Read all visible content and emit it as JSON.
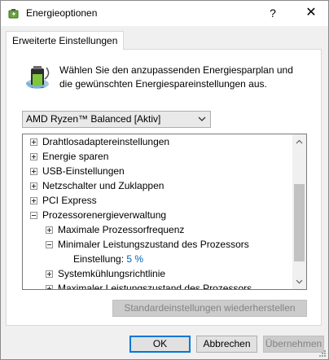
{
  "window": {
    "title": "Energieoptionen",
    "help_label": "?",
    "close_label": "✕"
  },
  "tab": {
    "label": "Erweiterte Einstellungen"
  },
  "description": "Wählen Sie den anzupassenden Energiesparplan und die gewünschten Energiespareinstellungen aus.",
  "plan_select": {
    "value": "AMD Ryzen™ Balanced [Aktiv]"
  },
  "tree": {
    "items": [
      {
        "label": "Drahtlosadaptereinstellungen",
        "state": "collapsed"
      },
      {
        "label": "Energie sparen",
        "state": "collapsed"
      },
      {
        "label": "USB-Einstellungen",
        "state": "collapsed"
      },
      {
        "label": "Netzschalter und Zuklappen",
        "state": "collapsed"
      },
      {
        "label": "PCI Express",
        "state": "collapsed"
      },
      {
        "label": "Prozessorenergieverwaltung",
        "state": "expanded"
      },
      {
        "label": "Maximale Prozessorfrequenz",
        "state": "collapsed"
      },
      {
        "label": "Minimaler Leistungszustand des Prozessors",
        "state": "expanded"
      },
      {
        "label": "Einstellung:",
        "value": "5 %"
      },
      {
        "label": "Systemkühlungsrichtlinie",
        "state": "collapsed"
      },
      {
        "label": "Maximaler Leistungszustand des Prozessors",
        "state": "collapsed"
      }
    ]
  },
  "buttons": {
    "restore": "Standardeinstellungen wiederherstellen",
    "ok": "OK",
    "cancel": "Abbrechen",
    "apply": "Übernehmen"
  },
  "colors": {
    "link_value": "#0063b1",
    "default_button_border": "#0078d7"
  },
  "icons": [
    "battery-power-icon",
    "chevron-down-icon",
    "plus-toggle-icon",
    "minus-toggle-icon"
  ]
}
